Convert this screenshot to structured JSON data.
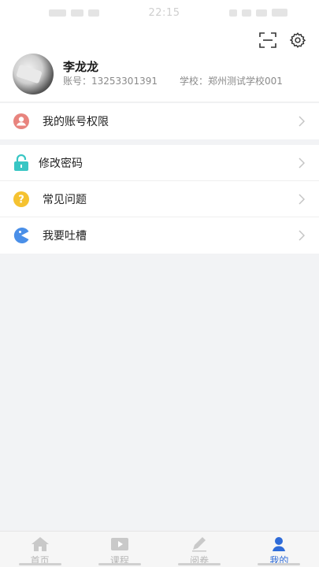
{
  "status_bar": {
    "time": "22:15"
  },
  "profile": {
    "name": "李龙龙",
    "account": "账号：13253301391",
    "school": "学校：郑州测试学校001"
  },
  "menu": {
    "group1": [
      {
        "label": "我的账号权限",
        "icon": "user-icon",
        "color": "#e8847e"
      }
    ],
    "group2": [
      {
        "label": "修改密码",
        "icon": "lock-icon",
        "color": "#38c6c4"
      },
      {
        "label": "常见问题",
        "icon": "question-icon",
        "color": "#f5c230"
      },
      {
        "label": "我要吐槽",
        "icon": "pacman-icon",
        "color": "#4a8fe8"
      }
    ]
  },
  "tabbar": {
    "tabs": [
      {
        "label": "首页",
        "icon": "home-icon",
        "active": false
      },
      {
        "label": "课程",
        "icon": "video-icon",
        "active": false
      },
      {
        "label": "阅卷",
        "icon": "pencil-icon",
        "active": false
      },
      {
        "label": "我的",
        "icon": "person-icon",
        "active": true
      }
    ]
  },
  "colors": {
    "accent": "#2e6bd8",
    "inactive": "#b7b7b7",
    "background": "#f2f3f5"
  }
}
